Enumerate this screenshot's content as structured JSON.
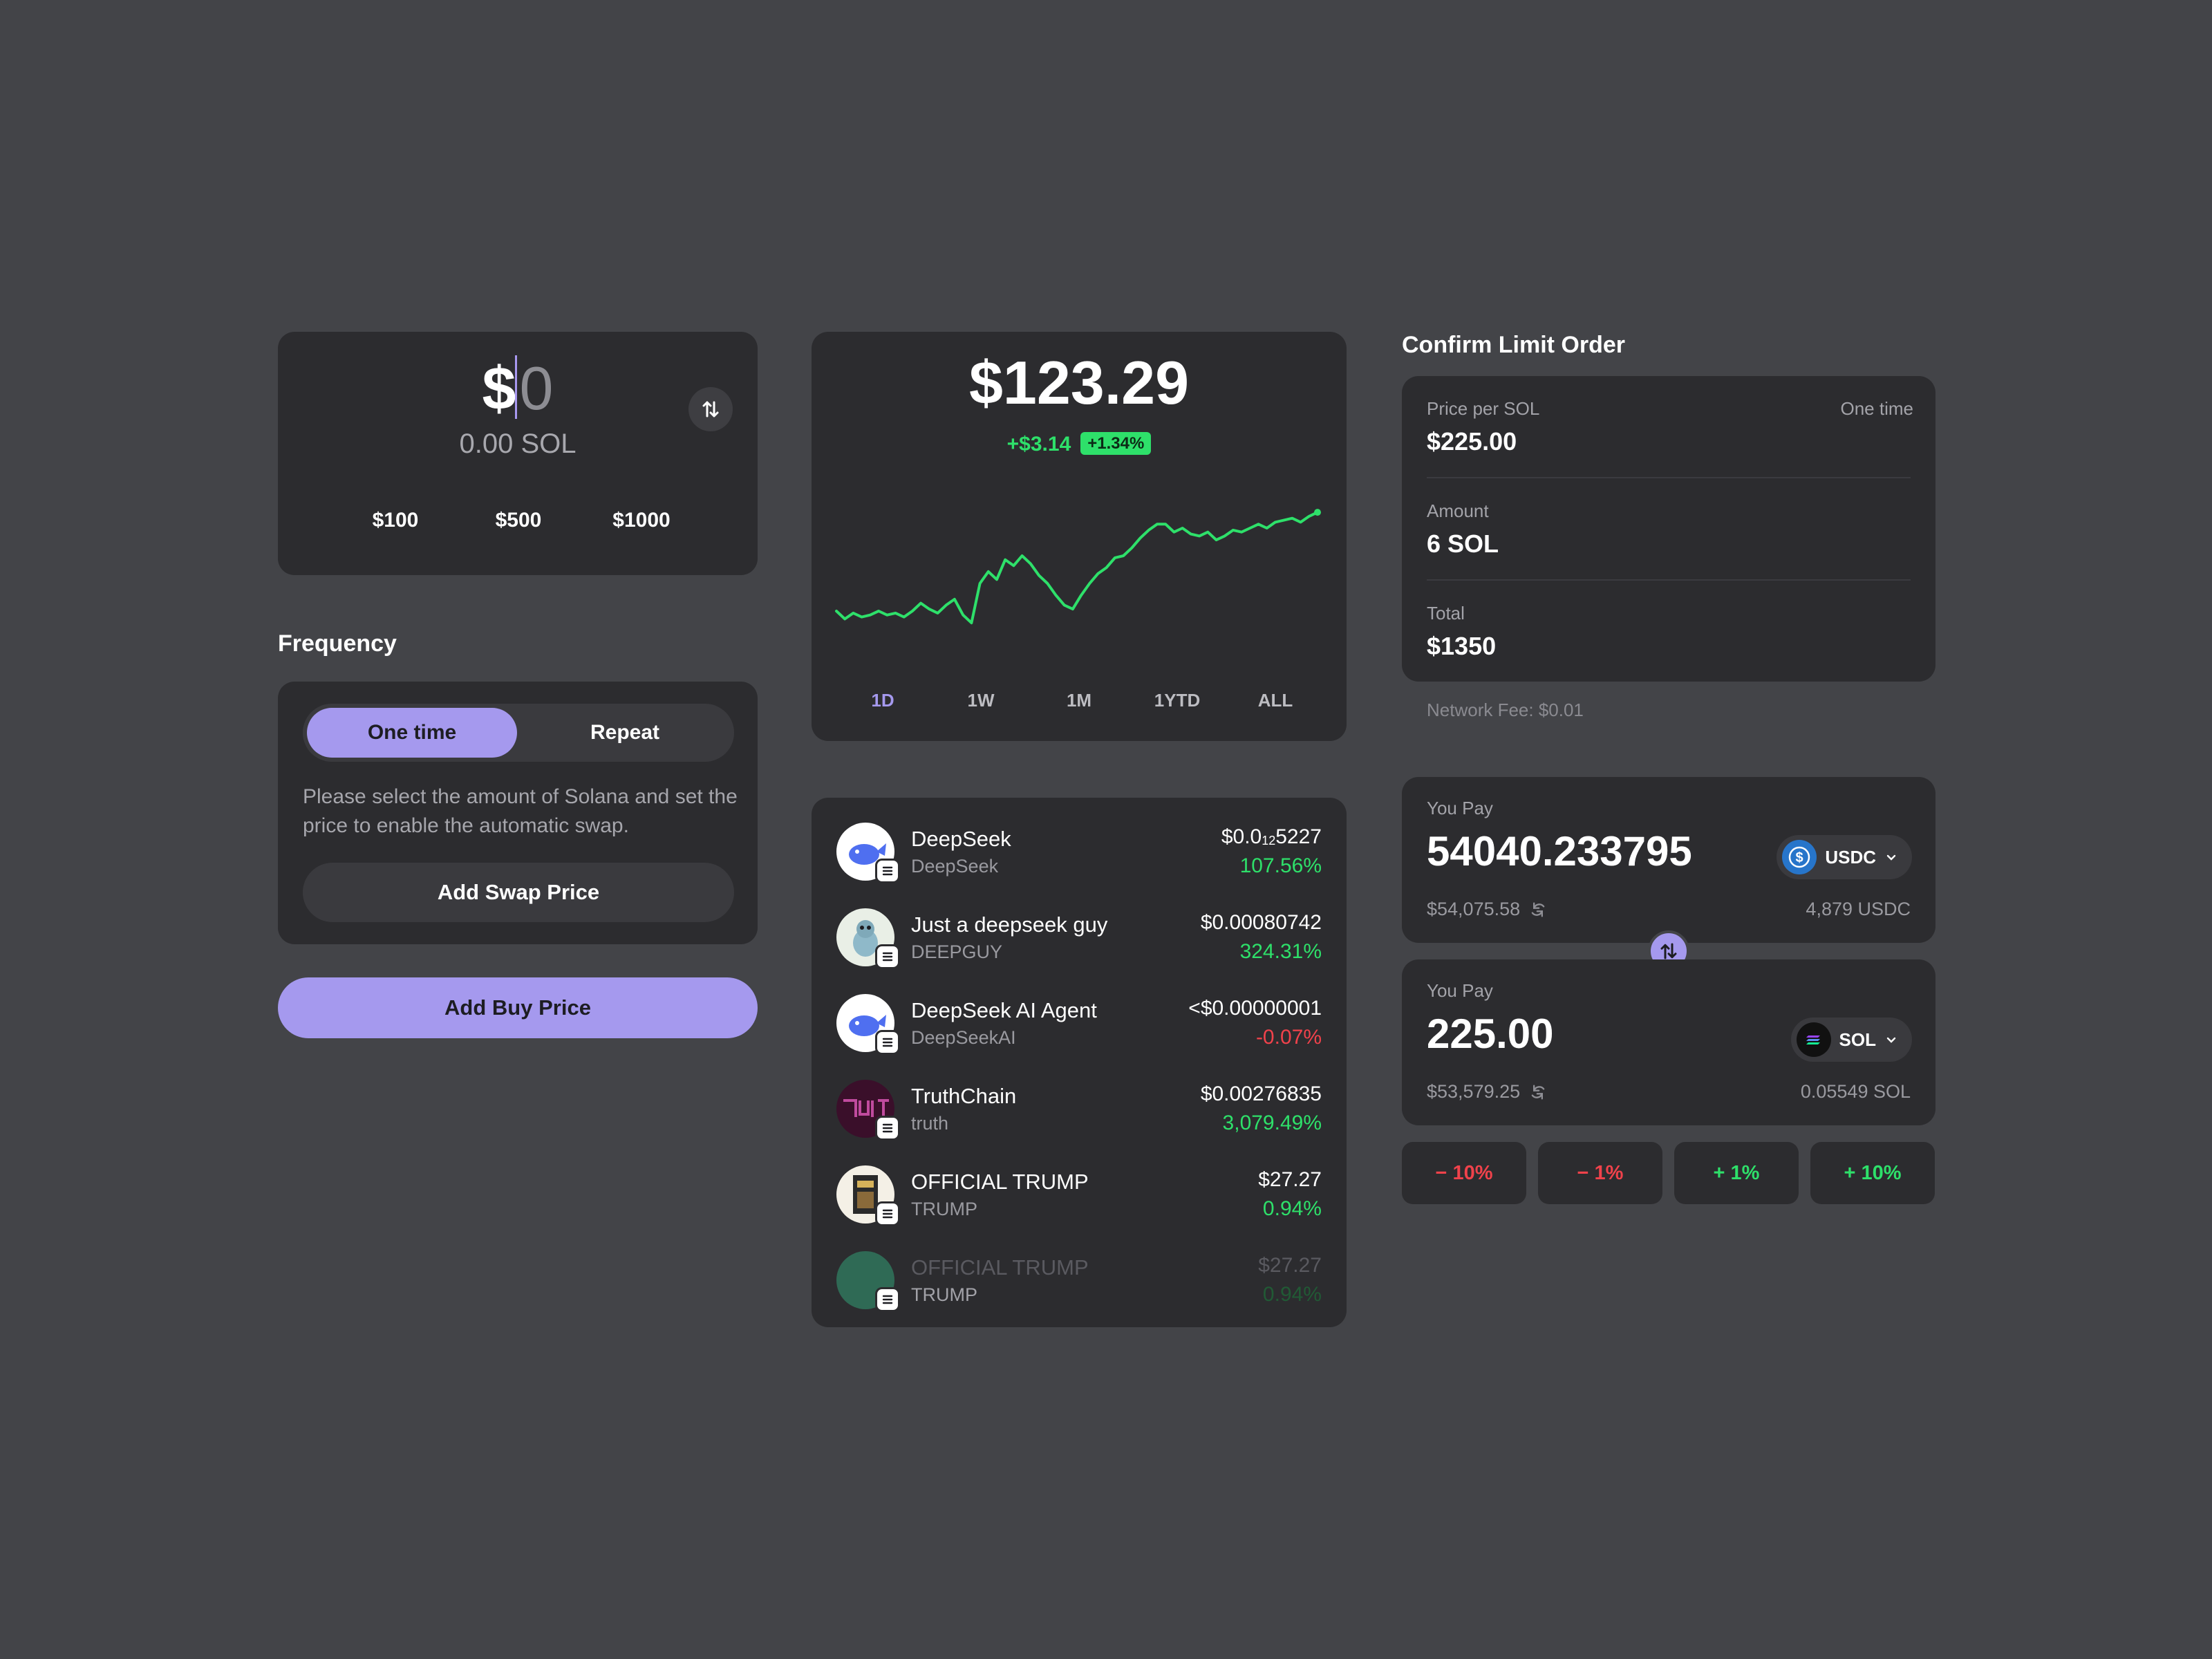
{
  "amount_card": {
    "currency_symbol": "$",
    "amount_value": "0",
    "sol_equivalent": "0.00 SOL",
    "quick_amounts": [
      "$100",
      "$500",
      "$1000"
    ]
  },
  "frequency": {
    "title": "Frequency",
    "options": [
      "One time",
      "Repeat"
    ],
    "selected": "One time",
    "description": "Please select the amount of Solana and set the price to enable the automatic swap.",
    "add_swap_label": "Add Swap Price"
  },
  "add_buy_label": "Add Buy Price",
  "price_chart": {
    "price": "$123.29",
    "change_abs": "+$3.14",
    "change_pct": "+1.34%",
    "ranges": [
      "1D",
      "1W",
      "1M",
      "1YTD",
      "ALL"
    ],
    "active_range": "1D",
    "accent_color": "#2ee06a"
  },
  "chart_data": {
    "type": "line",
    "values": [
      44,
      40,
      43,
      41,
      42,
      44,
      42,
      43,
      41,
      44,
      48,
      45,
      43,
      47,
      50,
      42,
      38,
      58,
      64,
      60,
      70,
      67,
      72,
      68,
      62,
      58,
      52,
      47,
      45,
      52,
      58,
      63,
      66,
      71,
      72,
      76,
      81,
      85,
      88,
      88,
      84,
      86,
      83,
      82,
      84,
      80,
      82,
      85,
      84,
      86,
      88,
      86,
      89,
      90,
      91,
      89,
      92,
      94
    ],
    "xlabel": "",
    "ylabel": ""
  },
  "tokens": [
    {
      "name": "DeepSeek",
      "symbol": "DeepSeek",
      "price_main": "$0.0",
      "price_sub": "12",
      "price_tail": "5227",
      "change": "107.56%",
      "direction": "pos",
      "avatar_color": "#4f6ff0",
      "avatar_bg": "#ffffff"
    },
    {
      "name": "Just a deepseek guy",
      "symbol": "DEEPGUY",
      "price_main": "$0.00080742",
      "price_sub": "",
      "price_tail": "",
      "change": "324.31%",
      "direction": "pos",
      "avatar_color": "#7fb3c8",
      "avatar_bg": "#e9efe6"
    },
    {
      "name": "DeepSeek AI Agent",
      "symbol": "DeepSeekAI",
      "price_main": "<$0.00000001",
      "price_sub": "",
      "price_tail": "",
      "change": "-0.07%",
      "direction": "neg",
      "avatar_color": "#4f6ff0",
      "avatar_bg": "#ffffff"
    },
    {
      "name": "TruthChain",
      "symbol": "truth",
      "price_main": "$0.00276835",
      "price_sub": "",
      "price_tail": "",
      "change": "3,079.49%",
      "direction": "pos",
      "avatar_color": "#c04b9e",
      "avatar_bg": "#3a0f2a"
    },
    {
      "name": "OFFICIAL TRUMP",
      "symbol": "TRUMP",
      "price_main": "$27.27",
      "price_sub": "",
      "price_tail": "",
      "change": "0.94%",
      "direction": "pos",
      "avatar_color": "#2a2a2a",
      "avatar_bg": "#f4f0e6"
    },
    {
      "name": "OFFICIAL TRUMP",
      "symbol": "TRUMP",
      "price_main": "$27.27",
      "price_sub": "",
      "price_tail": "",
      "change": "0.94%",
      "direction": "pos",
      "avatar_color": "#2f6a55",
      "avatar_bg": "#2f6a55"
    }
  ],
  "limit_order": {
    "title": "Confirm Limit Order",
    "price_label": "Price per SOL",
    "price_value": "$225.00",
    "frequency_tag": "One time",
    "amount_label": "Amount",
    "amount_value": "6 SOL",
    "total_label": "Total",
    "total_value": "$1350",
    "network_fee": "Network Fee: $0.01"
  },
  "swap": {
    "top": {
      "label": "You Pay",
      "amount": "54040.233795",
      "usd": "$54,075.58",
      "token": "USDC",
      "balance": "4,879 USDC"
    },
    "bottom": {
      "label": "You Pay",
      "amount": "225.00",
      "usd": "$53,579.25",
      "token": "SOL",
      "balance": "0.05549 SOL"
    }
  },
  "percent_buttons": [
    {
      "label": "10%",
      "sign": "−",
      "direction": "neg"
    },
    {
      "label": "1%",
      "sign": "−",
      "direction": "neg"
    },
    {
      "label": "1%",
      "sign": "+",
      "direction": "pos"
    },
    {
      "label": "10%",
      "sign": "+",
      "direction": "pos"
    }
  ]
}
